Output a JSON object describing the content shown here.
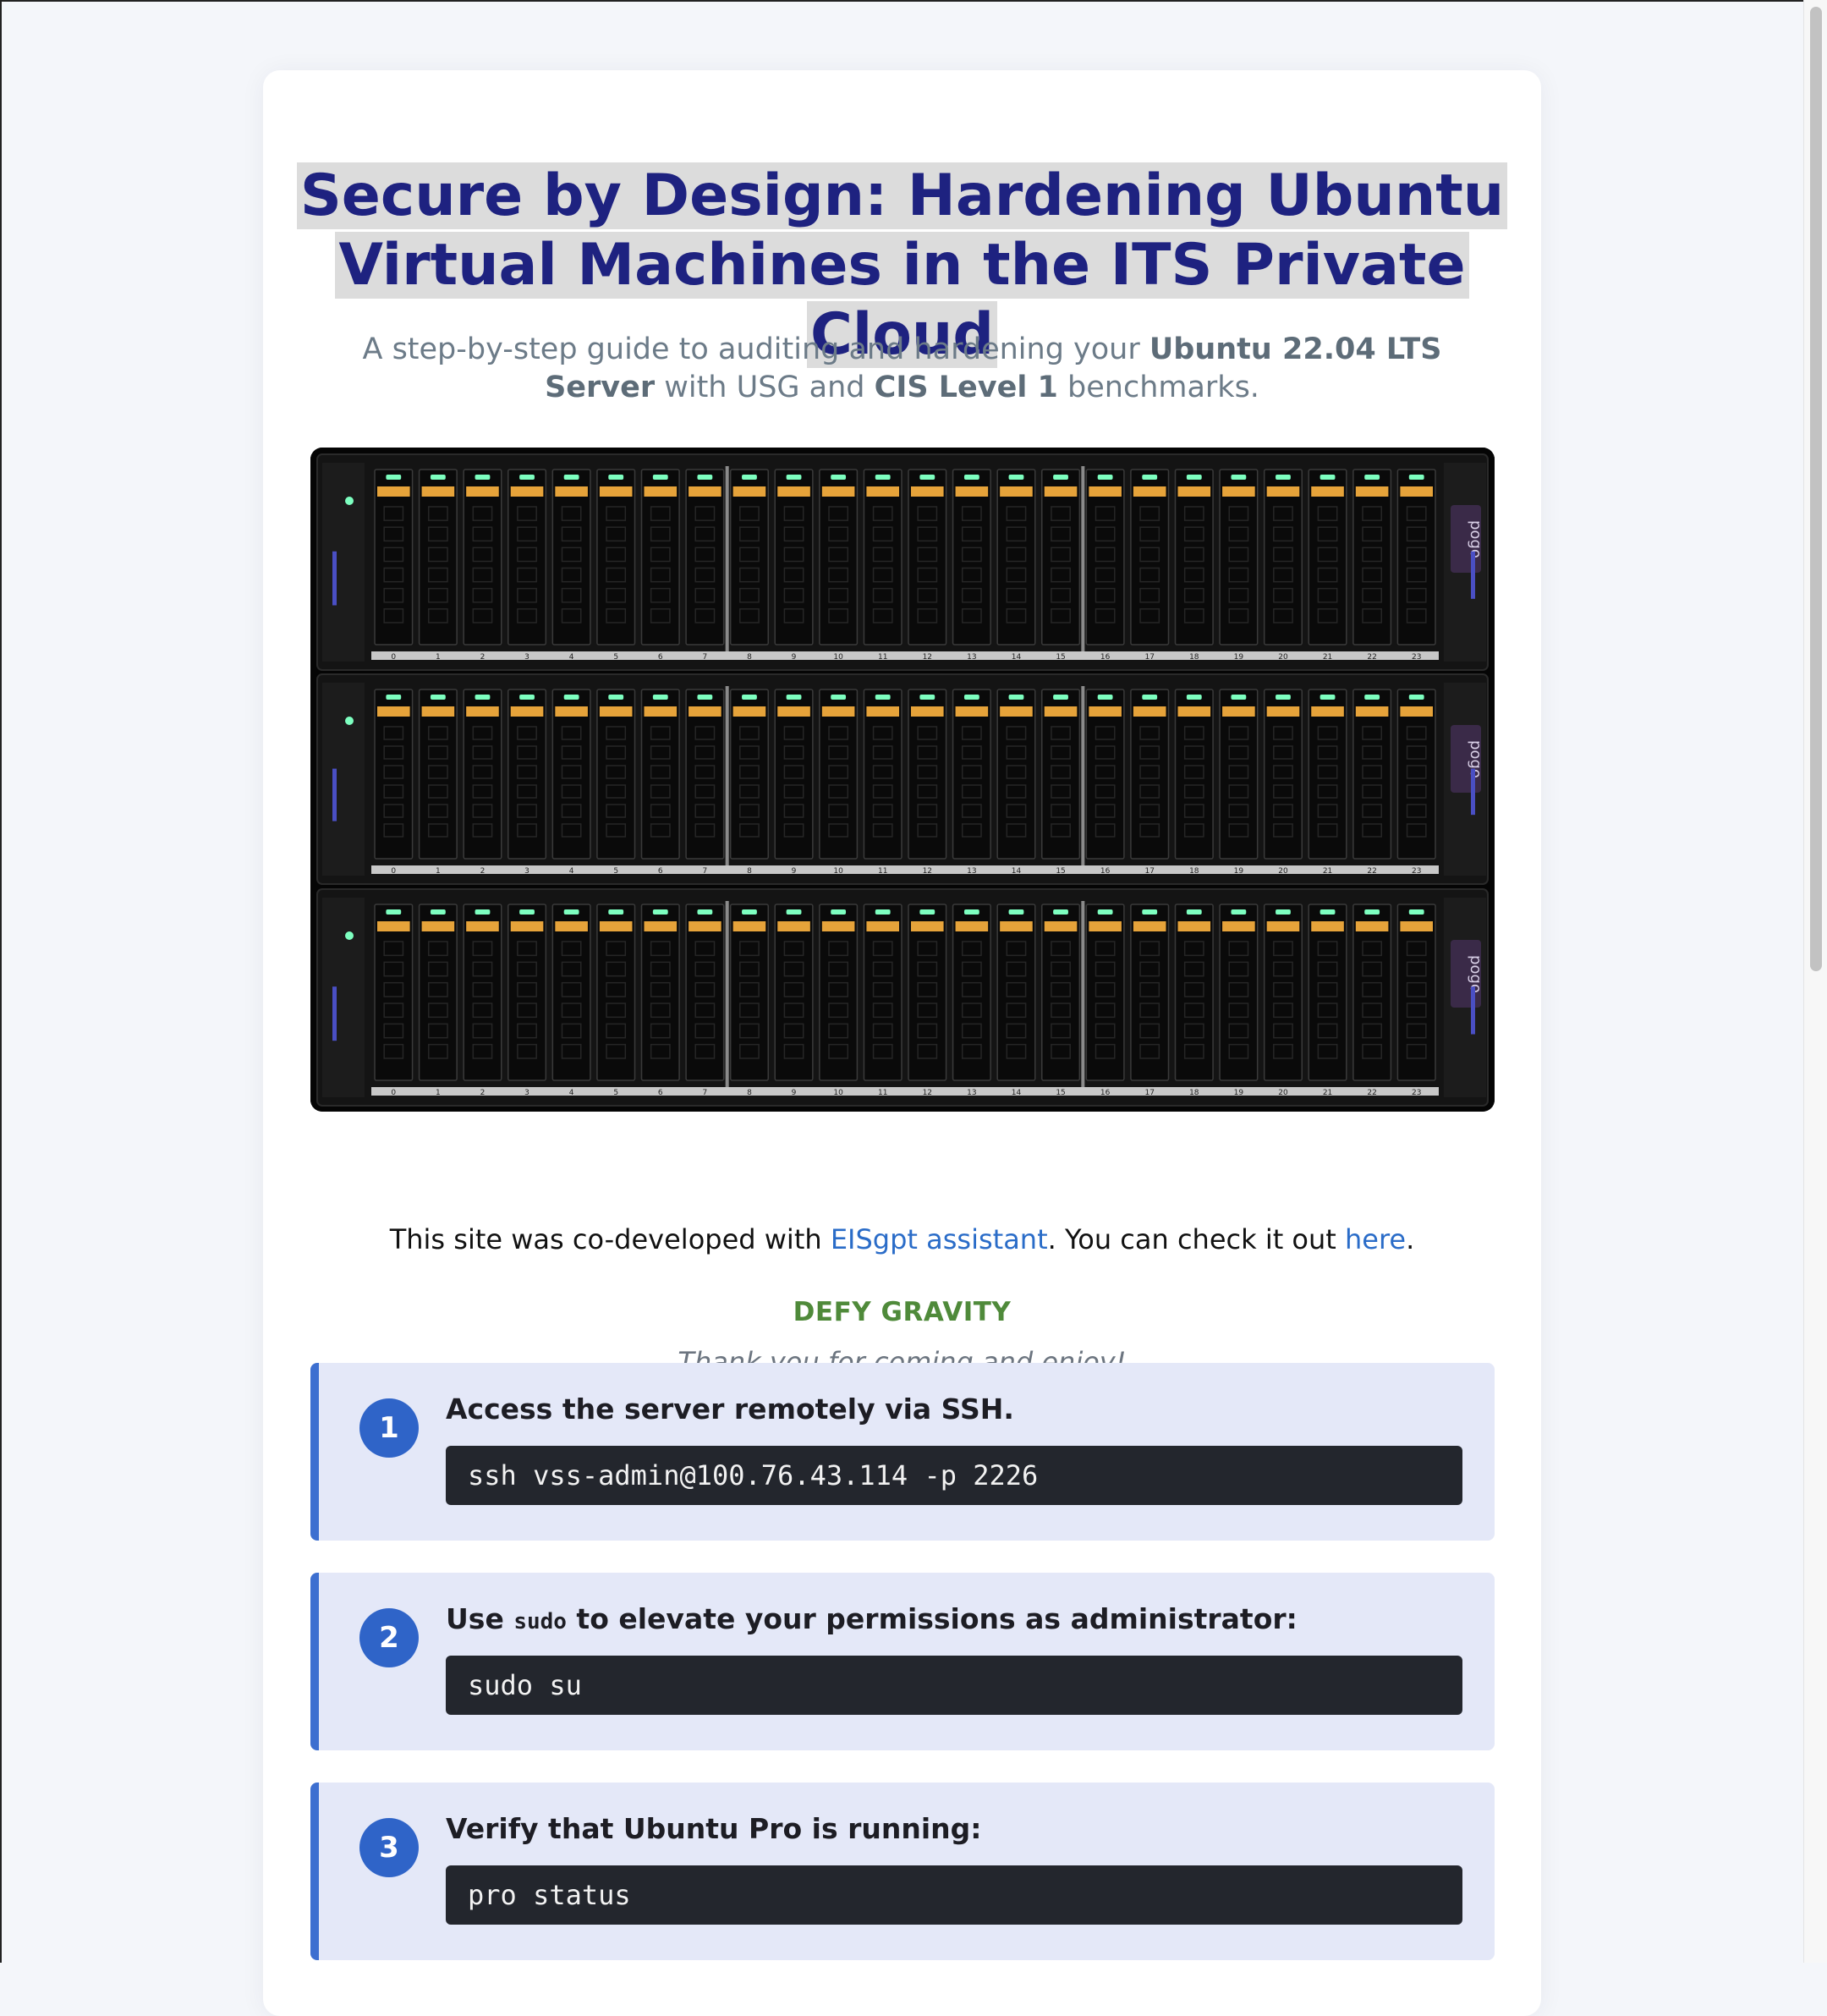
{
  "header": {
    "title": "Secure by Design: Hardening Ubuntu Virtual Machines in the ITS Private Cloud",
    "subtitle": {
      "part1": "A step-by-step guide to auditing and hardening your ",
      "bold1": "Ubuntu 22.04 LTS Server",
      "part2": " with USG and ",
      "bold2": "CIS Level 1",
      "part3": " benchmarks."
    }
  },
  "hero_image": {
    "description_icon": "server-rack-photo",
    "bay_labels": [
      "0",
      "1",
      "2",
      "3",
      "4",
      "5",
      "6",
      "7",
      "8",
      "9",
      "10",
      "11",
      "12",
      "13",
      "14",
      "15",
      "16",
      "17",
      "18",
      "19",
      "20",
      "21",
      "22",
      "23"
    ],
    "brand_label": "pogo",
    "colors": {
      "drive_led": "#7dffc0",
      "drive_tab": "#e6a33a",
      "chassis": "#0c0c0c",
      "rail": "#c8c8c8",
      "brand_plate": "#3a2a48"
    }
  },
  "credit": {
    "text1": "This site was co-developed with ",
    "link1": "EISgpt assistant",
    "text2": ". You can check it out ",
    "link2": "here",
    "text3": "."
  },
  "motto": "DEFY GRAVITY",
  "thanks": "Thank you for coming and enjoy!",
  "steps": [
    {
      "number": "1",
      "title": "Access the server remotely via SSH.",
      "code": "ssh vss-admin@100.76.43.114 -p 2226"
    },
    {
      "number": "2",
      "title_before": "Use ",
      "title_code": "sudo",
      "title_after": " to elevate your permissions as administrator:",
      "code": "sudo su"
    },
    {
      "number": "3",
      "title": "Verify that Ubuntu Pro is running:",
      "code": "pro status"
    }
  ],
  "colors": {
    "page_bg": "#f4f6fa",
    "title": "#1e2280",
    "title_highlight": "#dcdcdc",
    "link": "#2a6cc8",
    "motto": "#4f8a3a",
    "step_bg": "#e4e8f8",
    "step_accent": "#3d6fd0",
    "code_bg": "#23262d"
  }
}
